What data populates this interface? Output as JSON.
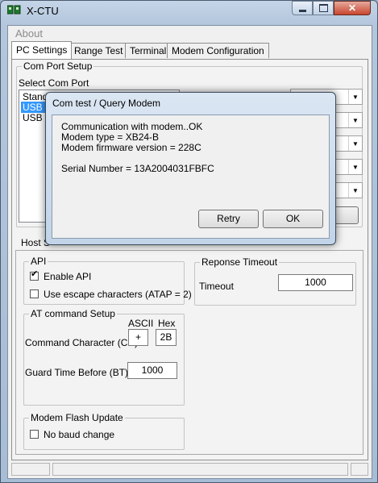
{
  "window": {
    "title": "X-CTU"
  },
  "menu": {
    "about": "About"
  },
  "tabs": [
    "PC Settings",
    "Range Test",
    "Terminal",
    "Modem Configuration"
  ],
  "com_port_setup": {
    "group_title": "Com Port Setup",
    "select_label": "Select Com Port",
    "ports": [
      "Stand",
      "USB S",
      "USB S"
    ],
    "selected_index": 1,
    "combo_values": [
      "",
      "",
      "",
      "",
      ""
    ]
  },
  "host_setup": {
    "tab_label": "Host S"
  },
  "api": {
    "group_title": "API",
    "enable_api": {
      "label": "Enable API",
      "checked": true
    },
    "escape": {
      "label": "Use escape characters (ATAP = 2)",
      "checked": false
    }
  },
  "at_command": {
    "group_title": "AT command Setup",
    "ascii_header": "ASCII",
    "hex_header": "Hex",
    "cc_label": "Command Character (CC)",
    "cc_ascii": "+",
    "cc_hex": "2B",
    "bt_label": "Guard Time Before (BT)",
    "bt_value": "1000"
  },
  "response_timeout": {
    "group_title": "Reponse Timeout",
    "timeout_label": "Timeout",
    "timeout_value": "1000"
  },
  "modem_flash": {
    "group_title": "Modem Flash Update",
    "no_baud": {
      "label": "No baud change",
      "checked": false
    }
  },
  "dialog": {
    "title": "Com test / Query Modem",
    "lines": [
      "Communication with modem..OK",
      "Modem type = XB24-B",
      "Modem firmware version = 228C",
      "",
      "Serial Number = 13A2004031FBFC"
    ],
    "retry_label": "Retry",
    "ok_label": "OK"
  },
  "colors": {
    "selection": "#3399ff",
    "close_button": "#c8462f"
  }
}
